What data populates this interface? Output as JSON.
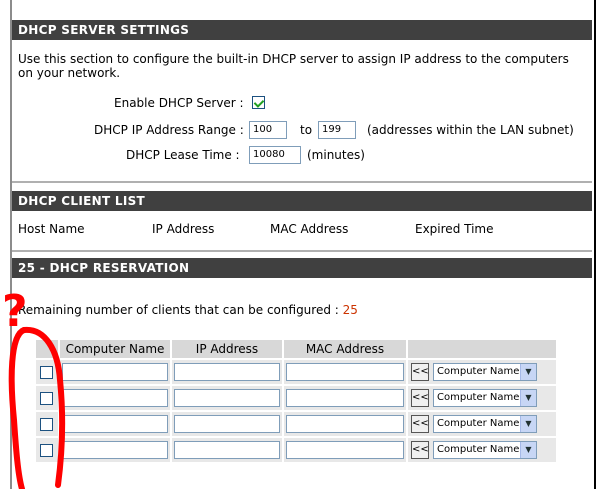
{
  "dhcp_server": {
    "title": "DHCP SERVER SETTINGS",
    "description": "Use this section to configure the built-in DHCP server to assign IP address to the computers on your network.",
    "enable_label": "Enable DHCP Server :",
    "enable_checked": true,
    "range_label": "DHCP IP Address Range :",
    "range_start": "100",
    "range_to": "to",
    "range_end": "199",
    "range_note": "(addresses within the LAN subnet)",
    "lease_label": "DHCP Lease Time :",
    "lease_value": "10080",
    "lease_unit": "(minutes)"
  },
  "dhcp_client_list": {
    "title": "DHCP CLIENT LIST",
    "columns": [
      "Host Name",
      "IP Address",
      "MAC Address",
      "Expired Time"
    ]
  },
  "dhcp_reservation": {
    "title": "25 - DHCP RESERVATION",
    "remaining_label": "Remaining number of clients that can be configured :",
    "remaining_count": "25",
    "remaining_color": "#cc3300",
    "columns": [
      "Computer Name",
      "IP Address",
      "MAC Address"
    ],
    "copy_button_label": "<<",
    "select_value": "Computer Name",
    "rows": 4
  },
  "annotation": {
    "mark": "?",
    "color": "#ff0000"
  }
}
